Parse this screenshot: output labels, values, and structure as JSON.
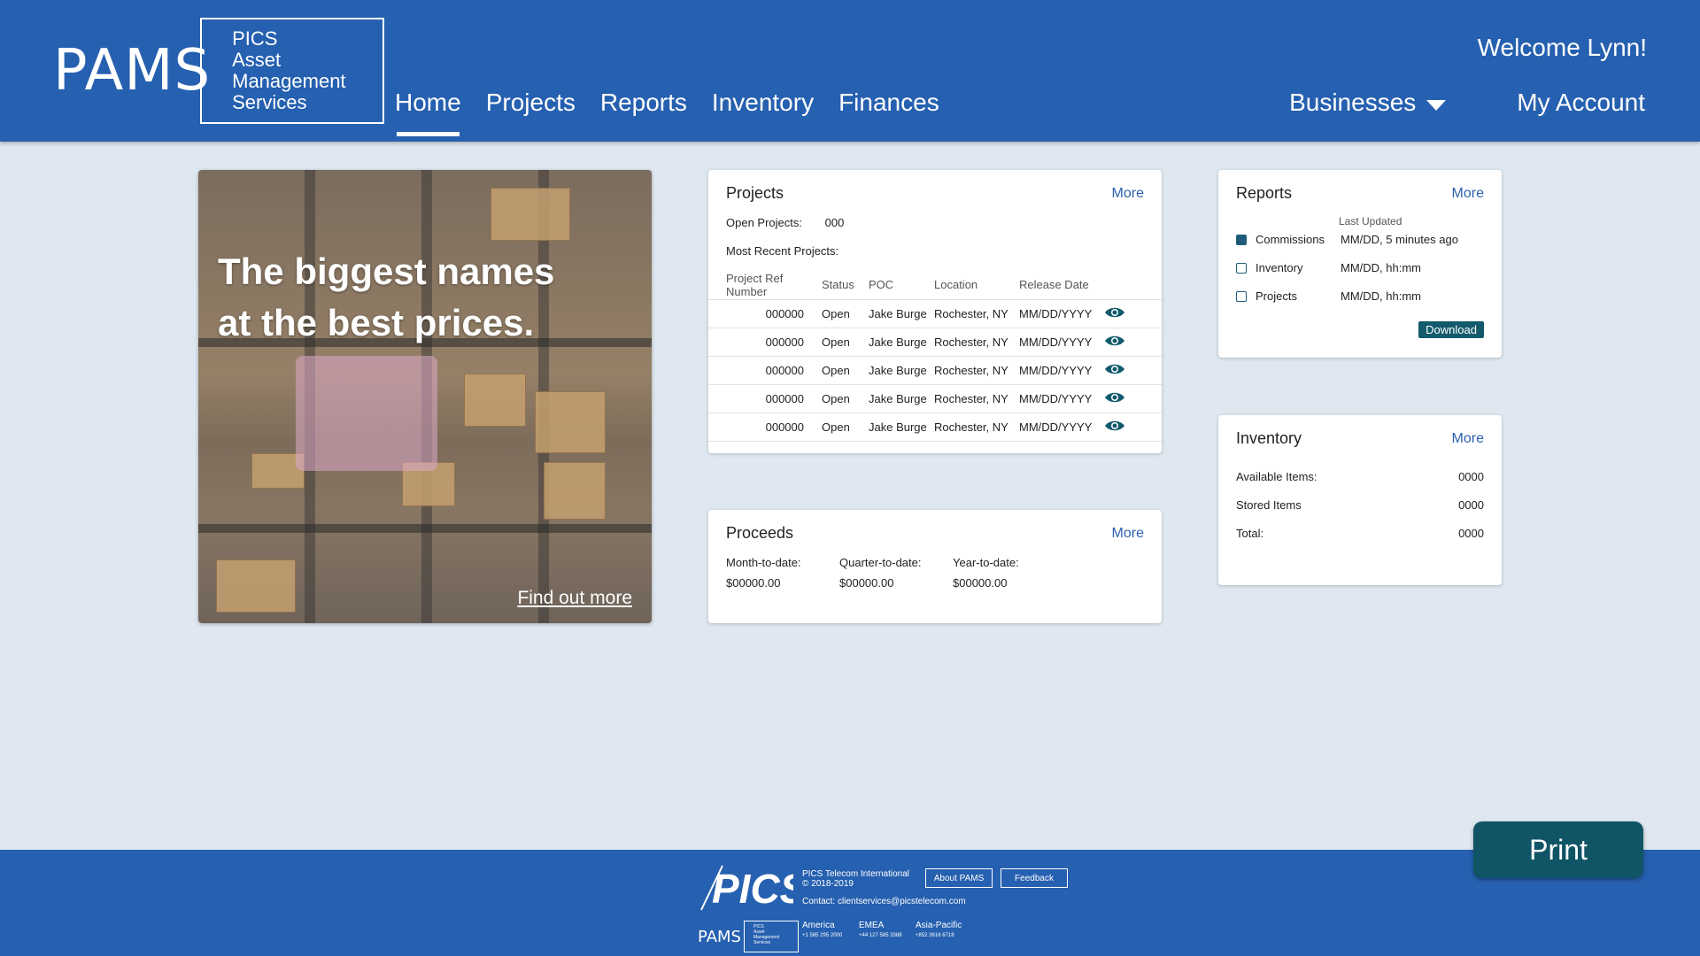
{
  "header": {
    "logo_word": "PAMS",
    "logo_lines": [
      "PICS",
      "Asset",
      "Management",
      "Services"
    ],
    "nav": [
      "Home",
      "Projects",
      "Reports",
      "Inventory",
      "Finances"
    ],
    "active_nav": "Home",
    "welcome": "Welcome Lynn!",
    "businesses": "Businesses",
    "my_account": "My Account"
  },
  "hero": {
    "line1": "The biggest names",
    "line2": "at the best prices.",
    "link": "Find out more"
  },
  "projects": {
    "title": "Projects",
    "more": "More",
    "open_label": "Open Projects:",
    "open_value": "000",
    "recent_label": "Most Recent Projects:",
    "columns": [
      "Project Ref Number",
      "Status",
      "POC",
      "Location",
      "Release Date"
    ],
    "rows": [
      {
        "ref": "000000",
        "status": "Open",
        "poc": "Jake Burge",
        "location": "Rochester, NY",
        "date": "MM/DD/YYYY"
      },
      {
        "ref": "000000",
        "status": "Open",
        "poc": "Jake Burge",
        "location": "Rochester, NY",
        "date": "MM/DD/YYYY"
      },
      {
        "ref": "000000",
        "status": "Open",
        "poc": "Jake Burge",
        "location": "Rochester, NY",
        "date": "MM/DD/YYYY"
      },
      {
        "ref": "000000",
        "status": "Open",
        "poc": "Jake Burge",
        "location": "Rochester, NY",
        "date": "MM/DD/YYYY"
      },
      {
        "ref": "000000",
        "status": "Open",
        "poc": "Jake Burge",
        "location": "Rochester, NY",
        "date": "MM/DD/YYYY"
      }
    ]
  },
  "proceeds": {
    "title": "Proceeds",
    "more": "More",
    "items": [
      {
        "label": "Month-to-date:",
        "value": "$00000.00"
      },
      {
        "label": "Quarter-to-date:",
        "value": "$00000.00"
      },
      {
        "label": "Year-to-date:",
        "value": "$00000.00"
      }
    ]
  },
  "reports": {
    "title": "Reports",
    "more": "More",
    "last_updated_label": "Last Updated",
    "items": [
      {
        "name": "Commissions",
        "updated": "MM/DD, 5 minutes ago",
        "checked": true
      },
      {
        "name": "Inventory",
        "updated": "MM/DD, hh:mm",
        "checked": false
      },
      {
        "name": "Projects",
        "updated": "MM/DD, hh:mm",
        "checked": false
      }
    ],
    "download": "Download"
  },
  "inventory": {
    "title": "Inventory",
    "more": "More",
    "items": [
      {
        "label": "Available Items:",
        "value": "0000"
      },
      {
        "label": "Stored Items",
        "value": "0000"
      },
      {
        "label": "Total:",
        "value": "0000"
      }
    ]
  },
  "print": "Print",
  "footer": {
    "pics_logo": "PICS",
    "company": "PICS Telecom International",
    "copyright": "© 2018-2019",
    "about": "About PAMS",
    "feedback": "Feedback",
    "contact": "Contact: clientservices@picstelecom.com",
    "pams_word": "PAMS",
    "pams_lines": [
      "PICS",
      "Asset",
      "Management",
      "Services"
    ],
    "regions": [
      {
        "name": "America",
        "phone": "+1 585 295 2000"
      },
      {
        "name": "EMEA",
        "phone": "+44 127 585 3388"
      },
      {
        "name": "Asia-Pacific",
        "phone": "+852 3616 6718"
      }
    ]
  },
  "colors": {
    "brand_blue": "#2660b0",
    "background": "#dfe7f0",
    "teal": "#125a6c",
    "link": "#2a5fae"
  }
}
